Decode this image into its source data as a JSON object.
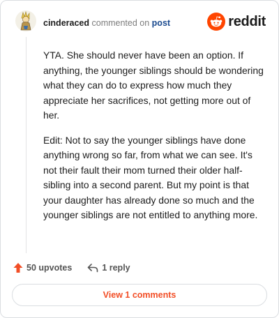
{
  "comment": {
    "username": "cinderaced",
    "action_text": "commented on",
    "post_link": "post",
    "paragraphs": [
      "YTA. She should never have been an option. If anything, the younger siblings should be wondering what they can do to express how much they appreciate her sacrifices, not getting more out of her.",
      "Edit: Not to say the younger siblings have done anything wrong so far, from what we can see. It's not their fault their mom turned their older half-sibling into a second parent. But my point is that your daughter has already done so much and the younger siblings are not entitled to anything more."
    ]
  },
  "brand": {
    "name": "reddit",
    "color": "#ff4500"
  },
  "actions": {
    "upvotes_label": "50 upvotes",
    "reply_label": "1 reply",
    "view_comments_label": "View 1 comments"
  },
  "icons": {
    "avatar": "avatar-icon",
    "reddit_logo": "reddit-logo-icon",
    "upvote": "upvote-arrow-icon",
    "reply": "reply-arrow-icon"
  },
  "colors": {
    "accent": "#f24e26",
    "username": "#1c1c1c",
    "post_link": "#1a4a8f",
    "muted": "#7c7c7c"
  }
}
